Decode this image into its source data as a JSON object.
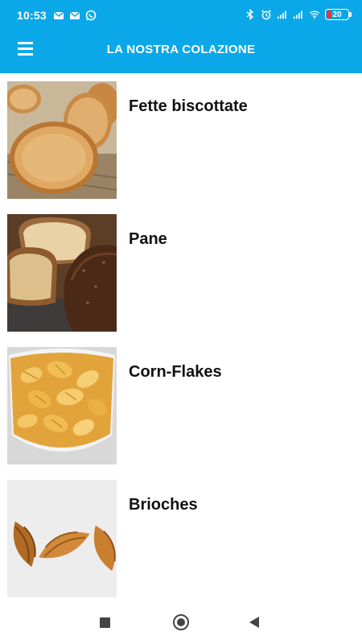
{
  "status_bar": {
    "time": "10:53",
    "battery_level": "20",
    "battery_fraction": 0.2,
    "left_icons": [
      "gmail-icon",
      "gmail-icon",
      "whatsapp-icon"
    ],
    "right_icons": [
      "bluetooth-icon",
      "alarm-icon",
      "signal-icon",
      "signal-icon",
      "wifi-icon",
      "battery-icon"
    ]
  },
  "app_bar": {
    "title": "LA NOSTRA COLAZIONE",
    "menu_icon": "hamburger-menu-icon"
  },
  "items": [
    {
      "label": "Fette biscottate",
      "image": "rusks-photo"
    },
    {
      "label": "Pane",
      "image": "bread-photo"
    },
    {
      "label": "Corn-Flakes",
      "image": "cornflakes-photo"
    },
    {
      "label": "Brioches",
      "image": "croissants-photo"
    }
  ],
  "nav_bar": {
    "buttons": [
      "recent-apps",
      "home",
      "back"
    ]
  },
  "colors": {
    "primary": "#0aa8e8",
    "text": "#111111",
    "battery_low": "#e53935"
  }
}
